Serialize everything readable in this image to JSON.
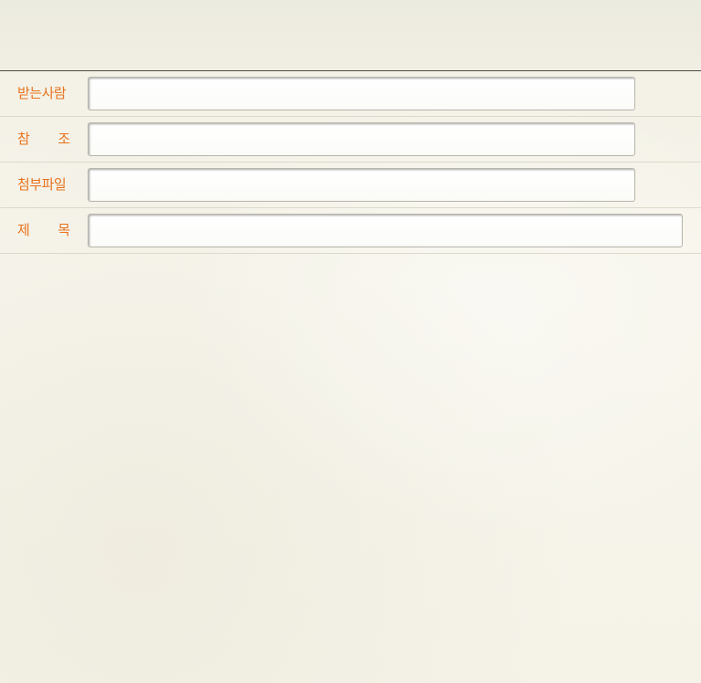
{
  "form": {
    "recipient": {
      "label": "받는사람",
      "value": "",
      "placeholder": ""
    },
    "cc": {
      "label_chars": [
        "참",
        "조"
      ],
      "value": "",
      "placeholder": ""
    },
    "attachment": {
      "label": "첨부파일",
      "value": "",
      "placeholder": ""
    },
    "subject": {
      "label_chars": [
        "제",
        "목"
      ],
      "value": "",
      "placeholder": ""
    }
  },
  "colors": {
    "label": "#e8731e",
    "background": "#f6f4ea",
    "divider": "#4a4a44"
  }
}
